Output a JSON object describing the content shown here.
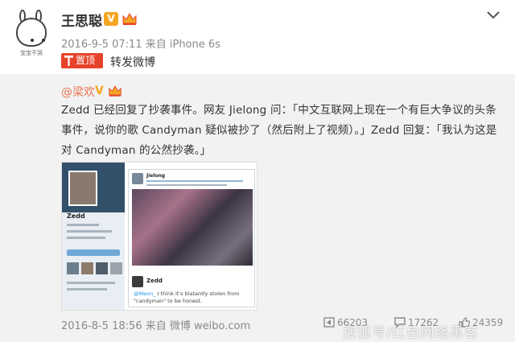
{
  "poster": {
    "name": "王思聪",
    "verified_badge": "V",
    "avatar_caption": "宝宝不哭",
    "meta": "2016-9-5 07:11  来自 iPhone 6s",
    "pinned_label": "置顶",
    "repost_label": "转发微博"
  },
  "original": {
    "author": "@梁欢",
    "verified_badge": "V",
    "text": "Zedd 已经回复了抄袭事件。网友 Jielong 问：「中文互联网上现在一个有巨大争议的头条事件，说你的歌 Candyman 疑似被抄了（然后附上了视频）。」Zedd 回复：「我认为这是对 Candyman 的公然抄袭。」",
    "media": {
      "profile_name": "Zedd",
      "tweet_author": "Jielong",
      "reply_author": "Zedd",
      "reply_handle": "@Meon_",
      "reply_text": " I think it's blatantly stolen from \"candyman\" to be honest."
    },
    "time_source": "2016-8-5 18:56  来自 微博 weibo.com"
  },
  "stats": {
    "reposts": "66203",
    "comments": "17262",
    "likes": "24359"
  },
  "watermark": "搜狐号/红色网络黑客",
  "icons": {
    "menu": "chevron-down-icon",
    "pinned": "pin-icon",
    "repost": "repost-icon",
    "comment": "comment-icon",
    "like": "thumbs-up-icon"
  },
  "colors": {
    "accent_orange": "#eb7350",
    "pinned_red": "#e6432b",
    "vip_gold": "#f5a623",
    "link_blue": "#1b95e0"
  }
}
